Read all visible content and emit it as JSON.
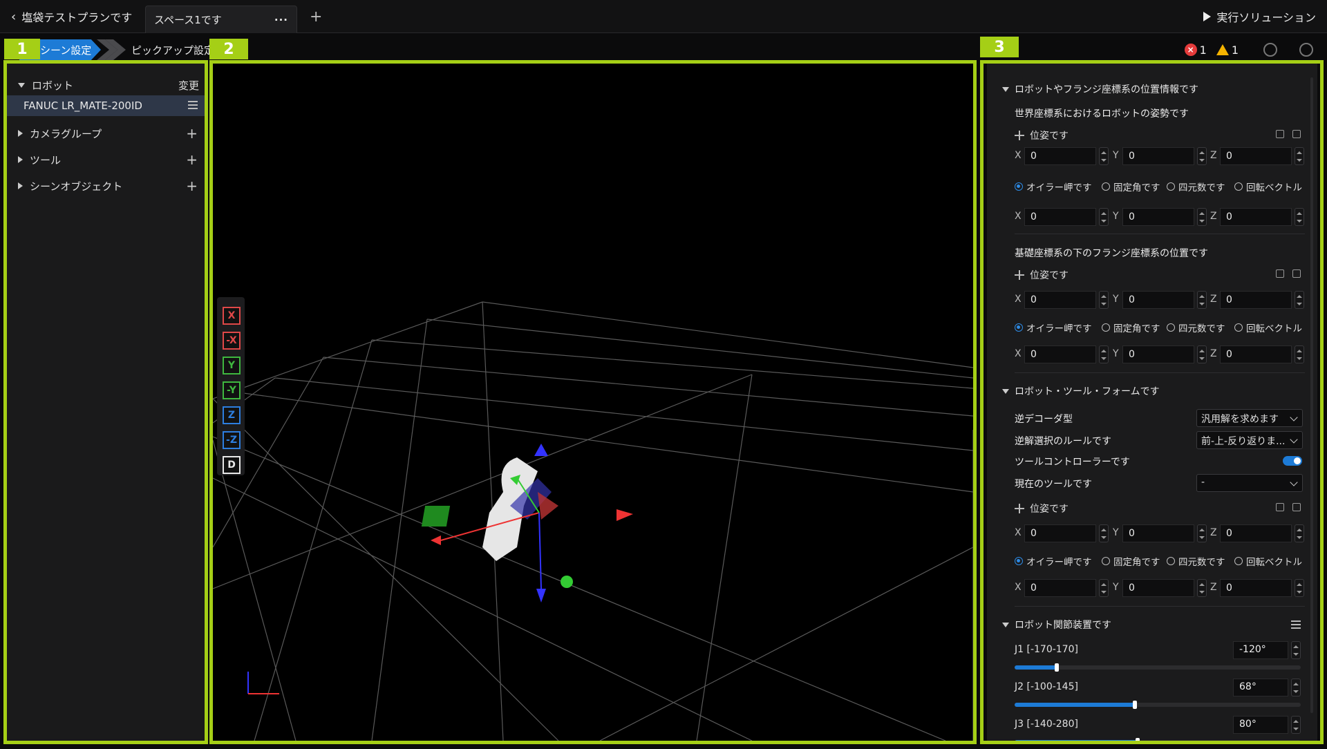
{
  "topbar": {
    "back_label": "塩袋テストプランです",
    "space_tab": "スペース1です",
    "tab_menu": "···",
    "add_tab": "+",
    "run_label": "実行ソリューション"
  },
  "section_tabs": {
    "active": "シーン設定",
    "next": "ピックアップ設定"
  },
  "status": {
    "errors": "1",
    "warnings": "1"
  },
  "markers": [
    "1",
    "2",
    "3"
  ],
  "scene_tree": {
    "robot_label": "ロボット",
    "robot_action": "変更",
    "robot_item": "FANUC LR_MATE-200ID",
    "camera_group": "カメラグループ",
    "tool": "ツール",
    "scene_objects": "シーンオブジェクト",
    "plus": "+"
  },
  "axis_buttons": [
    {
      "label": "X",
      "color": "#e04848"
    },
    {
      "label": "-X",
      "color": "#e04848"
    },
    {
      "label": "Y",
      "color": "#3fb83f"
    },
    {
      "label": "-Y",
      "color": "#3fb83f"
    },
    {
      "label": "Z",
      "color": "#2d7ee0"
    },
    {
      "label": "-Z",
      "color": "#2d7ee0"
    },
    {
      "label": "D",
      "color": "#e8e8e8"
    }
  ],
  "props": {
    "section1": "ロボットやフランジ座標系の位置情報です",
    "world_pose_title": "世界座標系におけるロボットの姿勢です",
    "pose_label": "位姿です",
    "flange_title": "基礎座標系の下のフランジ座標系の位置です",
    "section2": "ロボット・ツール・フォームです",
    "ik_type_label": "逆デコーダ型",
    "ik_type_value": "汎用解を求めます",
    "ik_rule_label": "逆解選択のルールです",
    "ik_rule_value": "前-上-反り返りま...",
    "tool_controller_label": "ツールコントローラーです",
    "current_tool_label": "現在のツールです",
    "current_tool_value": "-",
    "section3": "ロボット関節装置です",
    "axis_x": "X",
    "axis_y": "Y",
    "axis_z": "Z",
    "zero": "0",
    "rot_options": [
      "オイラー岬です",
      "固定角です",
      "四元数です",
      "回転ベクトル"
    ]
  },
  "joints": [
    {
      "label": "J1 [-170-170]",
      "value": "-120°",
      "fraction": 0.147
    },
    {
      "label": "J2 [-100-145]",
      "value": "68°",
      "fraction": 0.42
    },
    {
      "label": "J3 [-140-280]",
      "value": "80°",
      "fraction": 0.43
    }
  ],
  "colors": {
    "highlight": "#a5cf16",
    "accent": "#1d7bd6"
  }
}
